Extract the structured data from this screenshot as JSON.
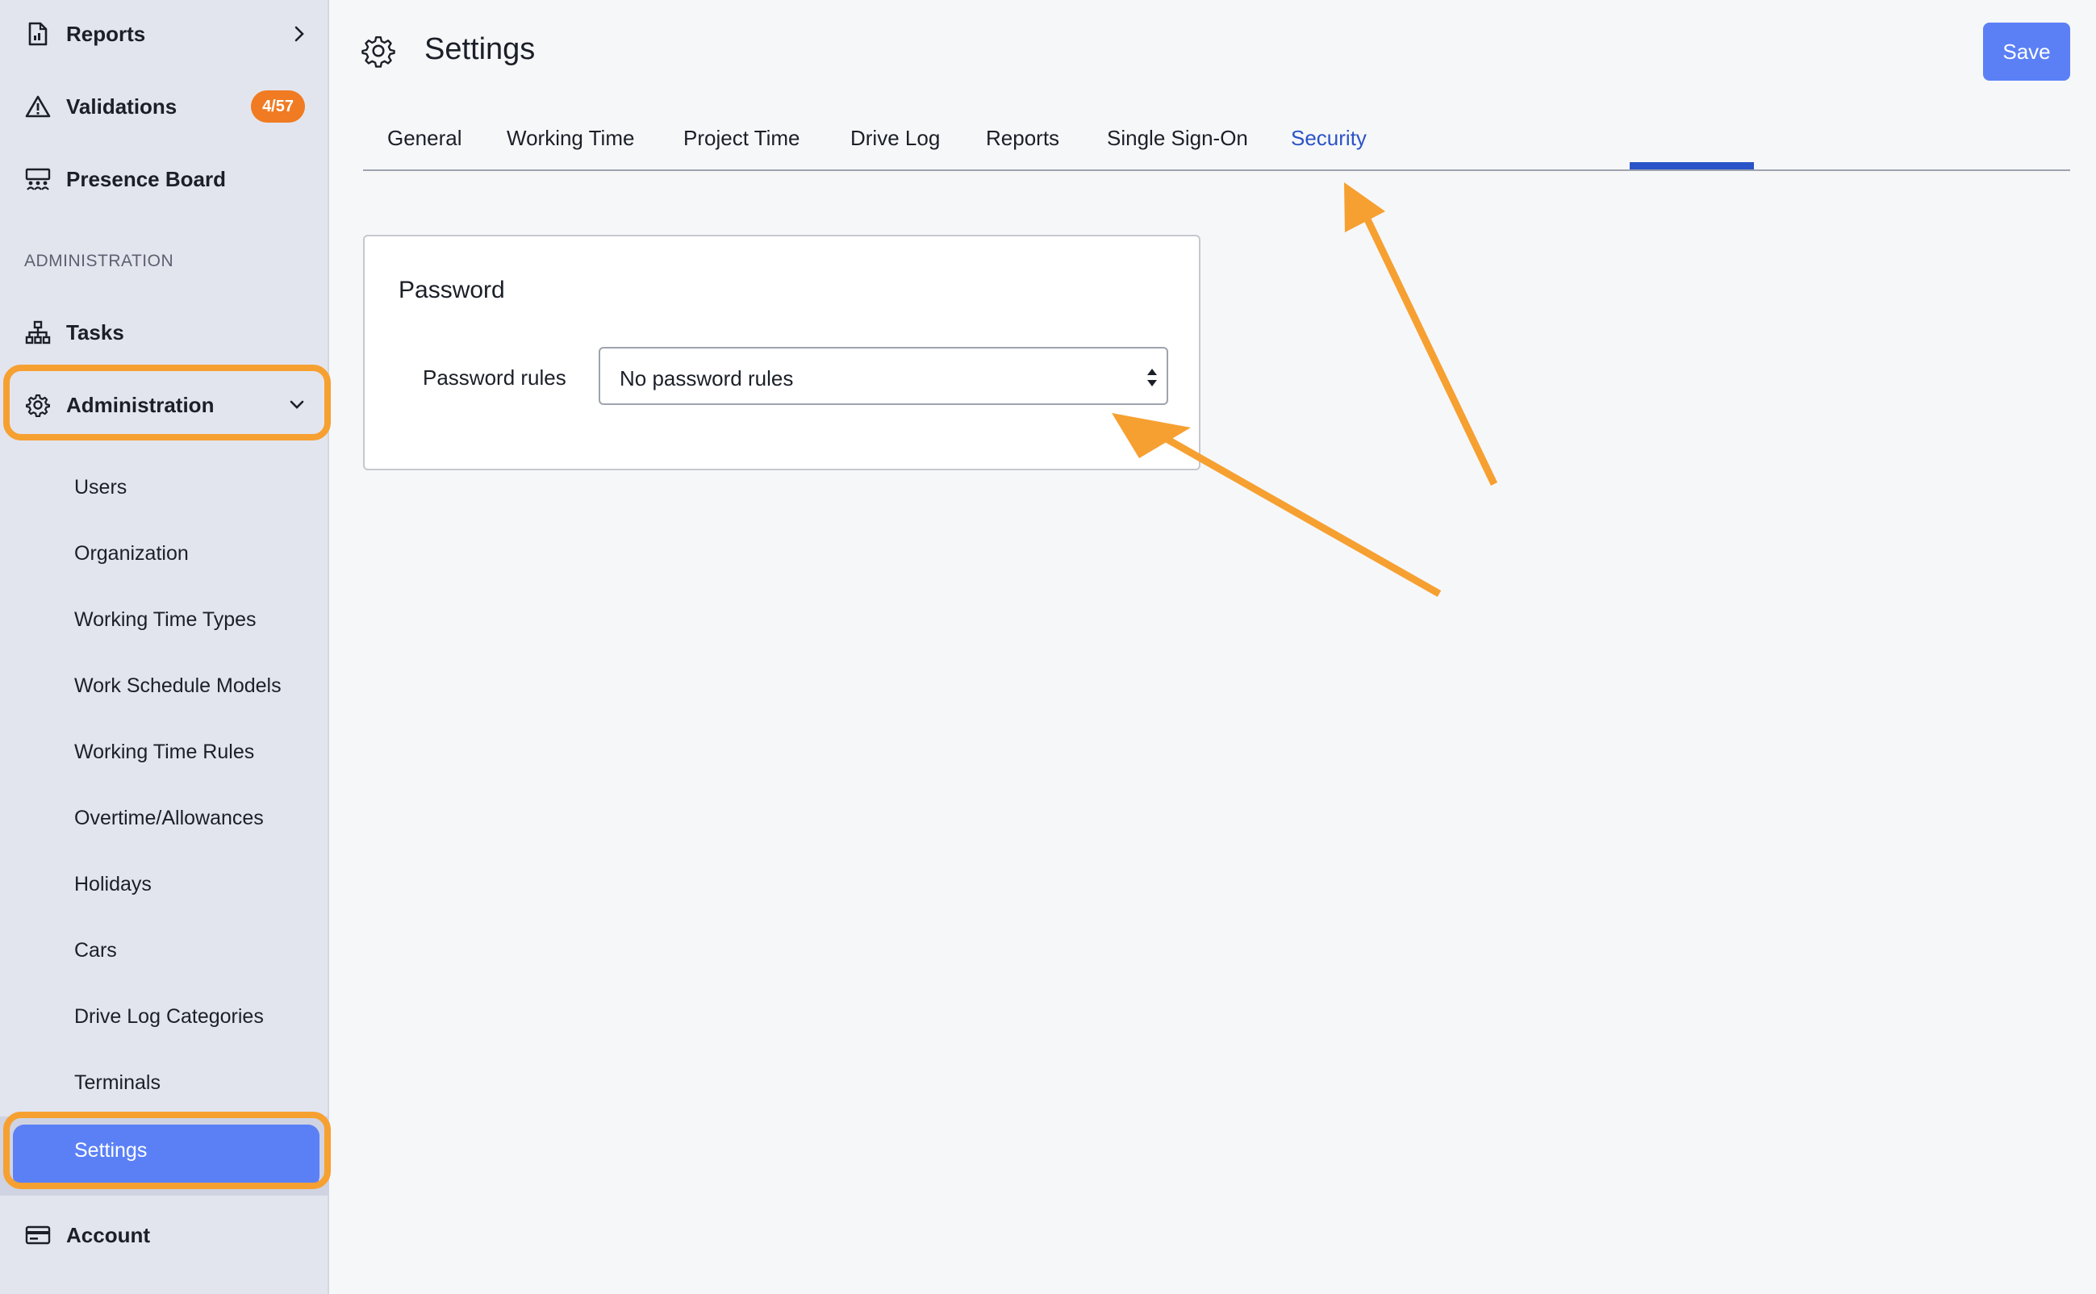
{
  "sidebar": {
    "top_items": [
      {
        "label": "Reports",
        "icon": "report-icon"
      },
      {
        "label": "Validations",
        "icon": "warning-icon",
        "badge": "4/57"
      },
      {
        "label": "Presence Board",
        "icon": "presence-board-icon"
      }
    ],
    "section_header": "ADMINISTRATION",
    "tasks": {
      "label": "Tasks",
      "icon": "hierarchy-icon"
    },
    "administration": {
      "label": "Administration",
      "icon": "gear-icon"
    },
    "admin_items": [
      {
        "label": "Users"
      },
      {
        "label": "Organization"
      },
      {
        "label": "Working Time Types"
      },
      {
        "label": "Work Schedule Models"
      },
      {
        "label": "Working Time Rules"
      },
      {
        "label": "Overtime/Allowances"
      },
      {
        "label": "Holidays"
      },
      {
        "label": "Cars"
      },
      {
        "label": "Drive Log Categories"
      },
      {
        "label": "Terminals"
      },
      {
        "label": "Settings"
      }
    ],
    "account": {
      "label": "Account",
      "icon": "credit-card-icon"
    }
  },
  "header": {
    "title": "Settings",
    "save_label": "Save"
  },
  "tabs": [
    {
      "label": "General"
    },
    {
      "label": "Working Time"
    },
    {
      "label": "Project Time"
    },
    {
      "label": "Drive Log"
    },
    {
      "label": "Reports"
    },
    {
      "label": "Single Sign-On"
    },
    {
      "label": "Security",
      "active": true
    }
  ],
  "password_card": {
    "title": "Password",
    "field_label": "Password rules",
    "selected_value": "No password rules"
  },
  "colors": {
    "accent": "#5b80f6",
    "active_tab": "#2a53c7",
    "annotation": "#f6a031",
    "badge": "#f07b22"
  }
}
